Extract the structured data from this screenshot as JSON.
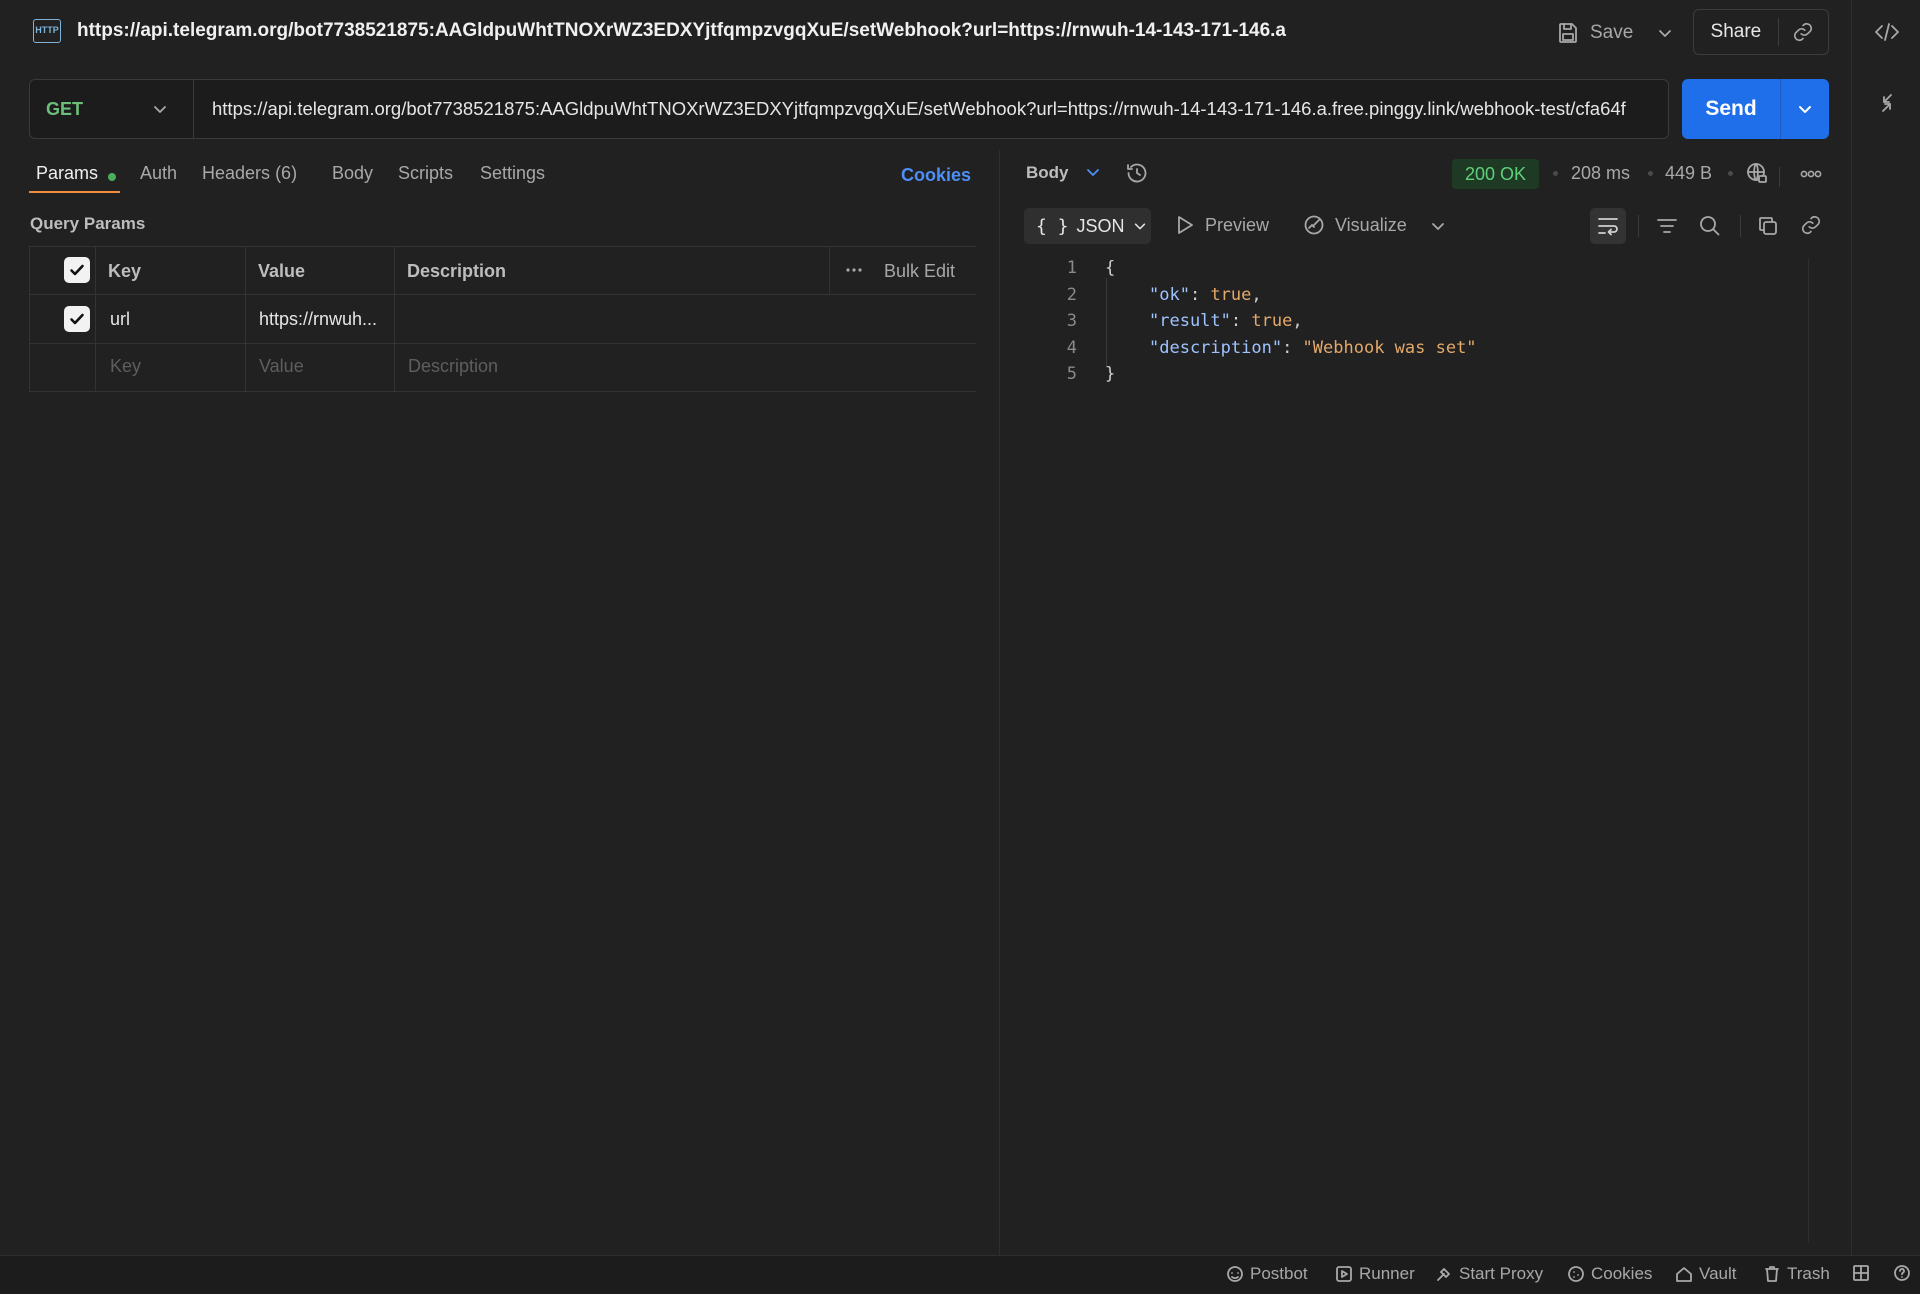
{
  "request": {
    "title": "https://api.telegram.org/bot7738521875:AAGldpuWhtTNOXrWZ3EDXYjtfqmpzvgqXuE/setWebhook?url=https://rnwuh-14-143-171-146.a",
    "method": "GET",
    "url": "https://api.telegram.org/bot7738521875:AAGldpuWhtTNOXrWZ3EDXYjtfqmpzvgqXuE/setWebhook?url=https://rnwuh-14-143-171-146.a.free.pinggy.link/webhook-test/cfa64f",
    "http_icon": "HTTP"
  },
  "toolbar": {
    "save_label": "Save",
    "share_label": "Share",
    "send_label": "Send"
  },
  "tabs": [
    {
      "label": "Params",
      "active": true
    },
    {
      "label": "Auth"
    },
    {
      "label": "Headers",
      "count": "(6)"
    },
    {
      "label": "Body"
    },
    {
      "label": "Scripts"
    },
    {
      "label": "Settings"
    }
  ],
  "cookies_label": "Cookies",
  "query_params": {
    "title": "Query Params",
    "headers": {
      "key": "Key",
      "value": "Value",
      "description": "Description",
      "bulk_edit": "Bulk Edit"
    },
    "rows": [
      {
        "checked": true,
        "key": "url",
        "value": "https://rnwuh...",
        "description": ""
      }
    ],
    "placeholders": {
      "key": "Key",
      "value": "Value",
      "description": "Description"
    }
  },
  "response": {
    "body_label": "Body",
    "status": "200 OK",
    "time": "208 ms",
    "size": "449 B",
    "format": "JSON",
    "preview_label": "Preview",
    "visualize_label": "Visualize",
    "line_numbers": [
      "1",
      "2",
      "3",
      "4",
      "5"
    ],
    "json": {
      "open": "{",
      "close": "}",
      "ok_key": "\"ok\"",
      "ok_val": "true",
      "result_key": "\"result\"",
      "result_val": "true",
      "desc_key": "\"description\"",
      "desc_val": "\"Webhook was set\""
    }
  },
  "statusbar": {
    "postbot": "Postbot",
    "runner": "Runner",
    "proxy": "Start Proxy",
    "cookies": "Cookies",
    "vault": "Vault",
    "trash": "Trash"
  },
  "colors": {
    "accent": "#1f6feb",
    "method": "#6bbf7a",
    "status_ok": "#5fd07a",
    "tab_underline": "#f08c3a"
  }
}
